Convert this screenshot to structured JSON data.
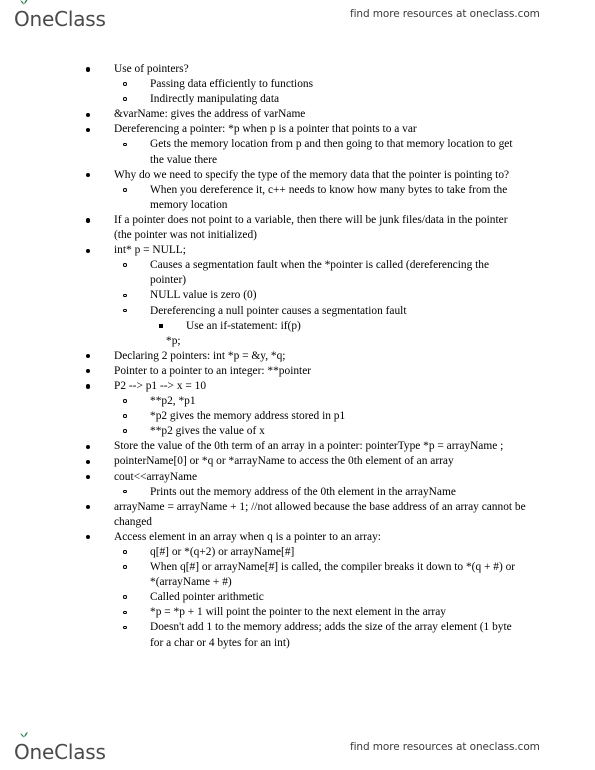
{
  "header": {
    "logo_text": "OneClass",
    "logo_icon": "leaf-sprout-icon",
    "tagline": "find more resources at oneclass.com"
  },
  "footer": {
    "logo_text": "OneClass",
    "logo_icon": "leaf-sprout-icon",
    "tagline": "find more resources at oneclass.com"
  },
  "colors": {
    "logo_text": "#4a4a4a",
    "logo_leaf": "#2e7d4f",
    "body_text": "#000000",
    "page_background": "#ffffff"
  },
  "notes": {
    "items": [
      {
        "text": "Use of pointers?",
        "children": [
          {
            "text": "Passing data efficiently to functions"
          },
          {
            "text": "Indirectly manipulating data"
          }
        ]
      },
      {
        "text": "&varName: gives the address of varName"
      },
      {
        "text": "Dereferencing a pointer: *p when p is a pointer that points to a var",
        "children": [
          {
            "text": "Gets the memory location from p and then going to that memory location to get the value there"
          }
        ]
      },
      {
        "text": "Why do we need to specify the type of the memory data that the pointer is pointing to?",
        "children": [
          {
            "text": "When you dereference it, c++ needs to know how many bytes to take from the memory location"
          }
        ]
      },
      {
        "text": "If a pointer does not point to a variable, then there will be junk files/data in the pointer (the pointer was not initialized)"
      },
      {
        "text": "int* p = NULL;",
        "children": [
          {
            "text": "Causes a segmentation fault when the *pointer is called (dereferencing the pointer)"
          },
          {
            "text": "NULL value is zero (0)"
          },
          {
            "text": "Dereferencing a null pointer causes a segmentation fault",
            "children": [
              {
                "text": "Use an if-statement: if(p)"
              }
            ]
          }
        ]
      },
      {
        "text": "Declaring 2 pointers: int *p = &y, *q;"
      },
      {
        "text": "Pointer to a pointer to an integer: **pointer"
      },
      {
        "text": "P2 --> p1 --> x = 10",
        "children": [
          {
            "text": "**p2, *p1"
          },
          {
            "text": "*p2 gives the memory address stored in p1"
          },
          {
            "text": "**p2 gives the value of x"
          }
        ]
      },
      {
        "text": "Store the value of the 0th term of an array in a pointer: pointerType *p = arrayName ;"
      },
      {
        "text": "pointerName[0] or *q or *arrayName to access the 0th element of an array"
      },
      {
        "text": "cout<<arrayName",
        "children": [
          {
            "text": "Prints out the memory address of the 0th element in the arrayName"
          }
        ]
      },
      {
        "text": "arrayName = arrayName + 1; //not allowed because the base address of an array cannot be changed"
      },
      {
        "text": "Access element in an array when q is a pointer to an array:",
        "children": [
          {
            "text": "q[#] or *(q+2) or arrayName[#]"
          },
          {
            "text": "When q[#] or arrayName[#] is called, the compiler breaks it down to *(q + #) or *(arrayName + #)"
          },
          {
            "text": "Called pointer arithmetic"
          },
          {
            "text": "*p = *p + 1 will point the pointer to the next element in the array"
          },
          {
            "text": "Doesn't add 1 to the memory address; adds the size of the array element (1 byte for a char or 4 bytes for an int)"
          }
        ]
      }
    ],
    "orphan_line": "*p;"
  }
}
